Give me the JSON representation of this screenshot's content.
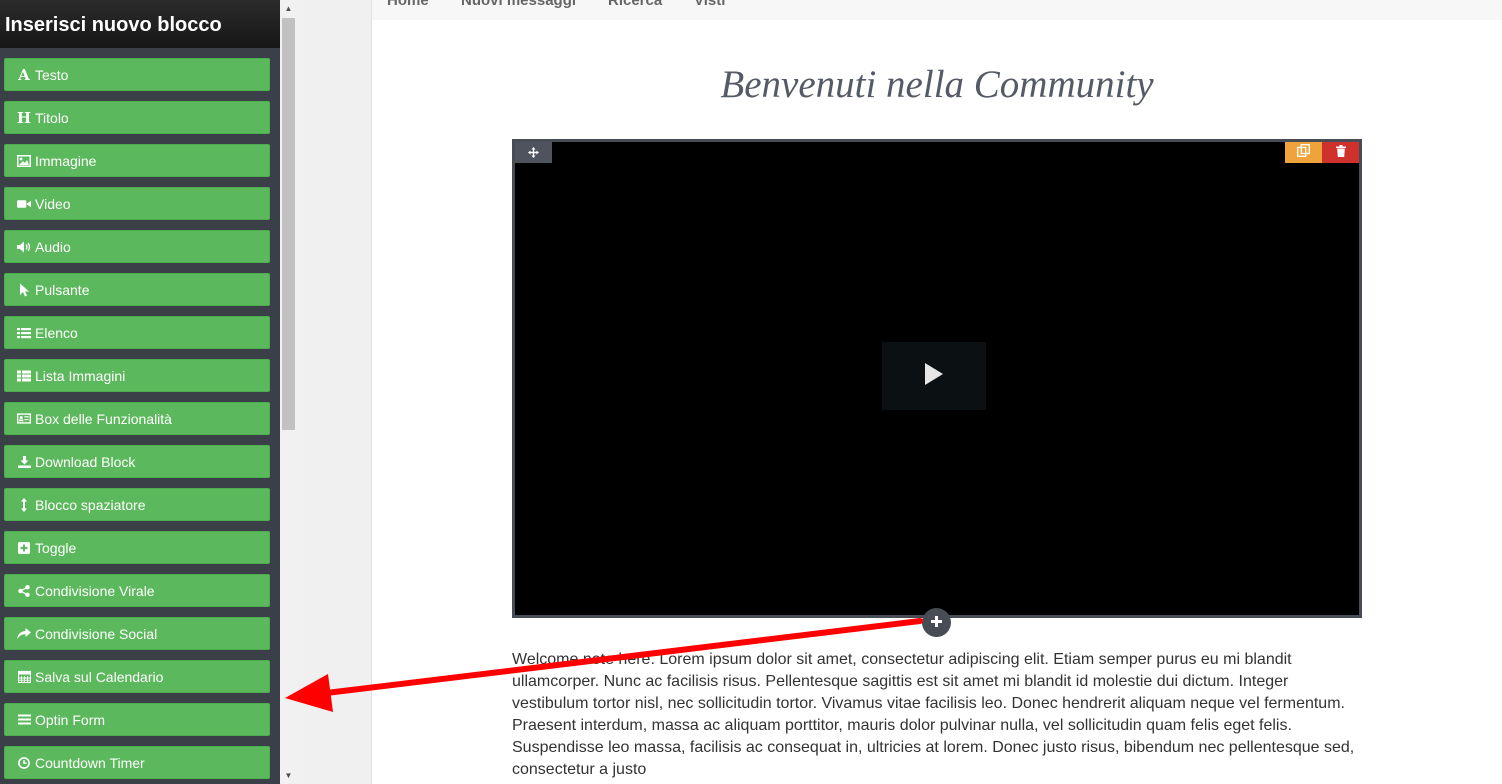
{
  "sidebar": {
    "title": "Inserisci nuovo blocco",
    "items": [
      {
        "label": "Testo",
        "icon": "text-a-icon"
      },
      {
        "label": "Titolo",
        "icon": "heading-h-icon"
      },
      {
        "label": "Immagine",
        "icon": "image-icon"
      },
      {
        "label": "Video",
        "icon": "video-camera-icon"
      },
      {
        "label": "Audio",
        "icon": "volume-icon"
      },
      {
        "label": "Pulsante",
        "icon": "pointer-icon"
      },
      {
        "label": "Elenco",
        "icon": "list-icon"
      },
      {
        "label": "Lista Immagini",
        "icon": "th-list-icon"
      },
      {
        "label": "Box delle Funzionalità",
        "icon": "id-card-icon"
      },
      {
        "label": "Download Block",
        "icon": "download-icon"
      },
      {
        "label": "Blocco spaziatore",
        "icon": "vertical-arrows-icon"
      },
      {
        "label": "Toggle",
        "icon": "plus-square-icon"
      },
      {
        "label": "Condivisione Virale",
        "icon": "share-alt-icon"
      },
      {
        "label": "Condivisione Social",
        "icon": "share-icon"
      },
      {
        "label": "Salva sul Calendario",
        "icon": "calendar-icon"
      },
      {
        "label": "Optin Form",
        "icon": "bars-icon"
      },
      {
        "label": "Countdown Timer",
        "icon": "clock-icon"
      }
    ]
  },
  "nav": {
    "items": [
      "Home",
      "Nuovi messaggi",
      "Ricerca",
      "Visti"
    ]
  },
  "content": {
    "heading": "Benvenuti nella Community",
    "paragraph": "Welcome note here. Lorem ipsum dolor sit amet, consectetur adipiscing elit. Etiam semper purus eu mi blandit ullamcorper. Nunc ac facilisis risus. Pellentesque sagittis est sit amet mi blandit id molestie dui dictum. Integer vestibulum tortor nisl, nec sollicitudin tortor. Vivamus vitae facilisis leo. Donec hendrerit aliquam neque vel fermentum. Praesent interdum, massa ac aliquam porttitor, mauris dolor pulvinar nulla, vel sollicitudin quam felis eget felis. Suspendisse leo massa, facilisis ac consequat in, ultricies at lorem. Donec justo risus, bibendum nec pellentesque sed, consectetur a justo"
  },
  "colors": {
    "button_green": "#5cb85c",
    "sidebar_bg": "#3a3f48",
    "copy_orange": "#efa33a",
    "delete_red": "#cf312c",
    "arrow_red": "#ff0000"
  }
}
